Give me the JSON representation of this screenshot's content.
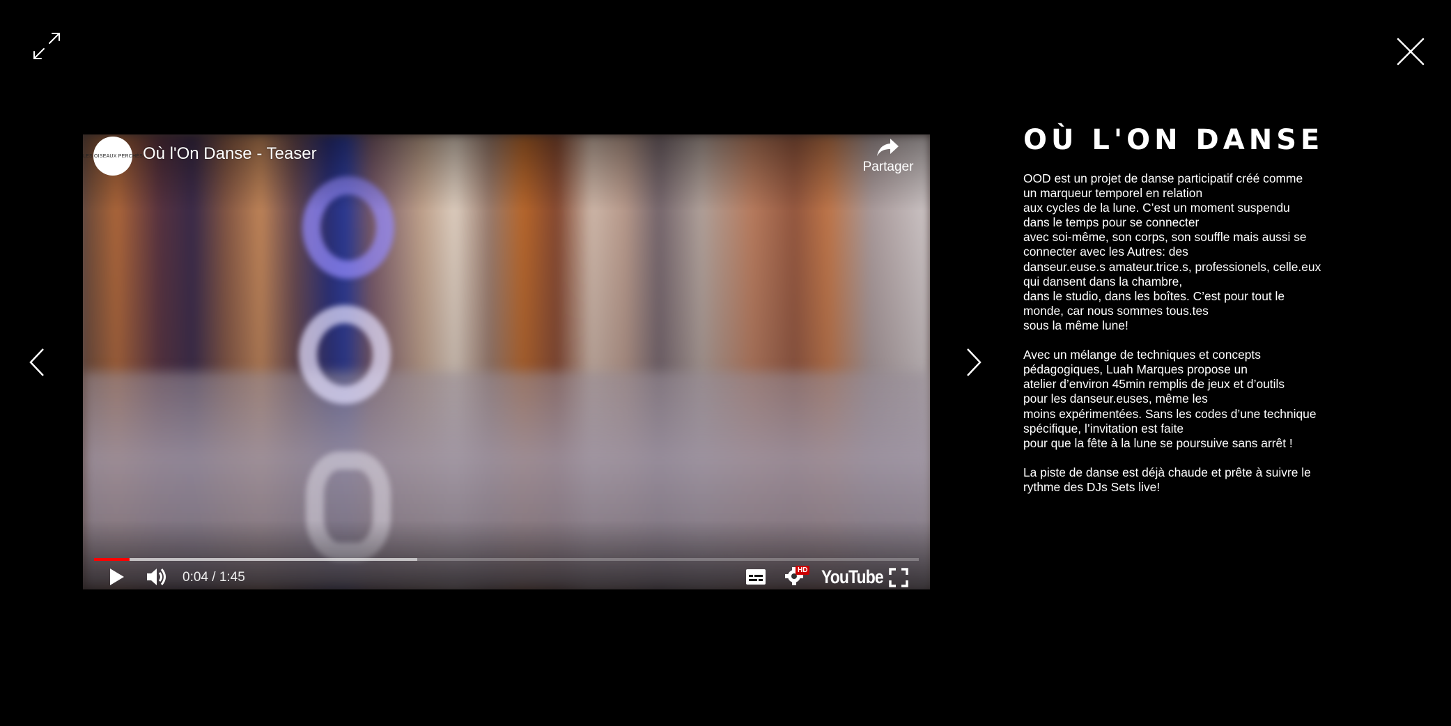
{
  "lightbox": {
    "expand_icon": "expand-arrows-icon",
    "close_icon": "close-x-icon",
    "prev_icon": "chevron-left-icon",
    "next_icon": "chevron-right-icon"
  },
  "video": {
    "channel_avatar_text": "LES OISEAUX PERCHÉS",
    "title": "Où l'On Danse - Teaser",
    "share_label": "Partager",
    "time_readout": "0:04 / 1:45",
    "played_fraction": 0.043,
    "buffered_fraction": 0.392,
    "hd_badge": "HD",
    "logo_text": "YouTube",
    "progress_color": "#ff0000"
  },
  "info": {
    "title": "OÙ L'ON DANSE",
    "paragraphs": [
      "OOD est un projet de danse participatif créé comme\nun marqueur temporel en relation\naux cycles de la lune. C’est un moment suspendu\ndans le temps pour se connecter\navec soi-même, son corps, son souffle mais aussi se\nconnecter avec les Autres: des\ndanseur.euse.s amateur.trice.s, professionels, celle.eux\nqui dansent dans la chambre,\ndans le studio, dans les boîtes. C’est pour tout le\nmonde, car nous sommes tous.tes\nsous la même lune!",
      "Avec un mélange de techniques et concepts\npédagogiques, Luah Marques propose un\natelier d’environ 45min remplis de jeux et d’outils\npour les danseur.euses, même les\nmoins expérimentées. Sans les codes d’une technique\nspécifique, l’invitation est faite\npour que la fête à la lune se poursuive sans arrêt !",
      "La piste de danse est déjà chaude et prête à suivre le\nrythme des DJs Sets live!"
    ]
  }
}
